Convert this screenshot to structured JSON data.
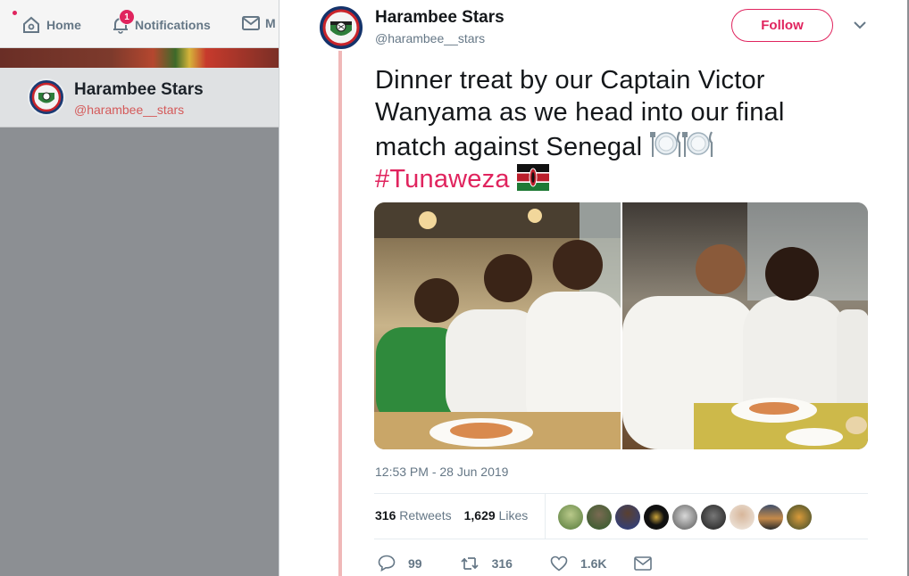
{
  "nav": {
    "home_label": "Home",
    "notifications_label": "Notifications",
    "notifications_count": "1",
    "messages_label": "M"
  },
  "background_profile": {
    "name": "Harambee Stars",
    "handle": "@harambee__stars"
  },
  "tweet": {
    "author_name": "Harambee Stars",
    "author_handle": "@harambee__stars",
    "follow_label": "Follow",
    "text": "Dinner treat by our Captain Victor Wanyama as we head into our final match against Senegal",
    "text_emojis": [
      "fork-knife-plate-icon",
      "fork-knife-plate-icon"
    ],
    "hashtag": "#Tunaweza",
    "hashtag_emoji": "kenya-flag-icon",
    "timestamp": "12:53 PM - 28 Jun 2019",
    "retweets_count": "316",
    "retweets_label": "Retweets",
    "likes_count": "1,629",
    "likes_label": "Likes",
    "reply_count": "99",
    "retweet_count": "316",
    "like_count": "1.6K",
    "liker_avatar_count": 9
  },
  "colors": {
    "accent": "#e0245e",
    "text": "#14171a",
    "secondary_text": "#657786",
    "overlay": "#8c8f93"
  }
}
